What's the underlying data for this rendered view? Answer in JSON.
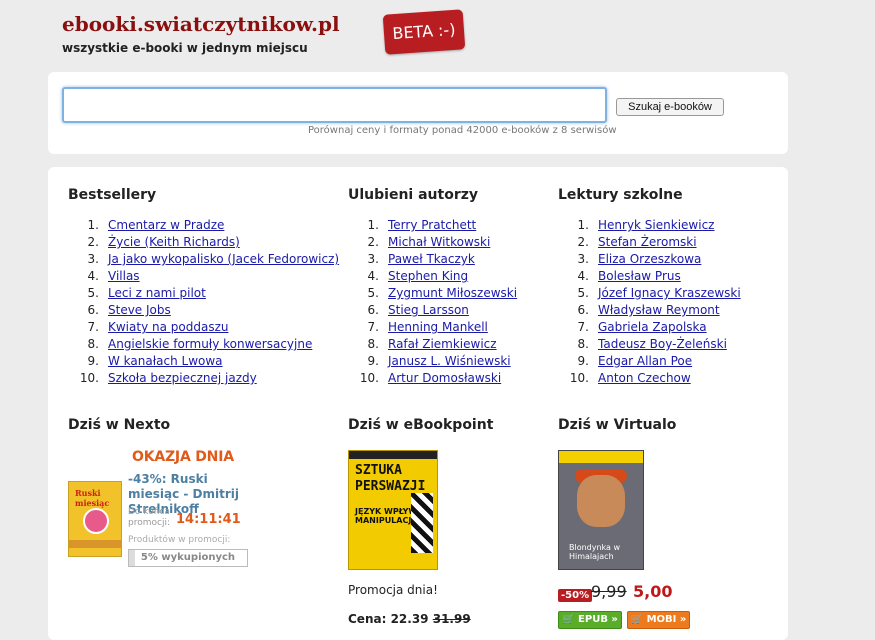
{
  "header": {
    "site_title": "ebooki.swiatczytnikow.pl",
    "tagline": "wszystkie e-booki w jednym miejscu",
    "beta_badge": "BETA :-)"
  },
  "search": {
    "value": "",
    "placeholder": "",
    "button_label": "Szukaj e-booków",
    "hint": "Porównaj ceny i formaty ponad 42000 e-booków z 8 serwisów"
  },
  "bestsellery": {
    "title": "Bestsellery",
    "items": [
      {
        "n": "1.",
        "label": "Cmentarz w Pradze"
      },
      {
        "n": "2.",
        "label": "Życie (Keith Richards)"
      },
      {
        "n": "3.",
        "label": "Ja jako wykopalisko (Jacek Fedorowicz)"
      },
      {
        "n": "4.",
        "label": "Villas"
      },
      {
        "n": "5.",
        "label": "Leci z nami pilot"
      },
      {
        "n": "6.",
        "label": "Steve Jobs"
      },
      {
        "n": "7.",
        "label": "Kwiaty na poddaszu"
      },
      {
        "n": "8.",
        "label": "Angielskie formuły konwersacyjne"
      },
      {
        "n": "9.",
        "label": "W kanałach Lwowa"
      },
      {
        "n": "10.",
        "label": "Szkoła bezpiecznej jazdy"
      }
    ]
  },
  "ulubieni": {
    "title": "Ulubieni autorzy",
    "items": [
      {
        "n": "1.",
        "label": "Terry Pratchett"
      },
      {
        "n": "2.",
        "label": "Michał Witkowski"
      },
      {
        "n": "3.",
        "label": "Paweł Tkaczyk"
      },
      {
        "n": "4.",
        "label": "Stephen King"
      },
      {
        "n": "5.",
        "label": "Zygmunt Miłoszewski"
      },
      {
        "n": "6.",
        "label": "Stieg Larsson"
      },
      {
        "n": "7.",
        "label": "Henning Mankell"
      },
      {
        "n": "8.",
        "label": "Rafał Ziemkiewicz"
      },
      {
        "n": "9.",
        "label": "Janusz L. Wiśniewski"
      },
      {
        "n": "10.",
        "label": "Artur Domosławski"
      }
    ]
  },
  "lektury": {
    "title": "Lektury szkolne",
    "items": [
      {
        "n": "1.",
        "label": "Henryk Sienkiewicz"
      },
      {
        "n": "2.",
        "label": "Stefan Żeromski"
      },
      {
        "n": "3.",
        "label": "Eliza Orzeszkowa"
      },
      {
        "n": "4.",
        "label": "Bolesław Prus"
      },
      {
        "n": "5.",
        "label": "Józef Ignacy Kraszewski"
      },
      {
        "n": "6.",
        "label": "Władysław Reymont"
      },
      {
        "n": "7.",
        "label": "Gabriela Zapolska"
      },
      {
        "n": "8.",
        "label": "Tadeusz Boy-Żeleński"
      },
      {
        "n": "9.",
        "label": "Edgar Allan Poe"
      },
      {
        "n": "10.",
        "label": "Anton Czechow"
      }
    ]
  },
  "nexto": {
    "title": "Dziś w Nexto",
    "banner": "OKAZJA DNIA",
    "book_title": "-43%: Ruski miesiąc - Dmitrij Strelnikoff",
    "cover_title": "Ruski miesiąc",
    "until_label": "Do końca promocji:",
    "timer": "14:11:41",
    "sold_label": "Produktów w promocji:",
    "sold_text": "5% wykupionych",
    "sold_fraction": 0.05
  },
  "ebookpoint": {
    "title": "Dziś w eBookpoint",
    "cover_line1": "SZTUKA",
    "cover_line2": "PERSWAZJI",
    "cover_line3": "JĘZYK WPŁYWU I MANIPULACJI",
    "promo": "Promocja dnia!",
    "price_label": "Cena: 22.39",
    "price_old": "31.99"
  },
  "virtualo": {
    "title": "Dziś w Virtualo",
    "cover_sub": "Blondynka w Himalajach",
    "discount": "-50%",
    "old_price": "9,99",
    "new_price": "5,00",
    "epub_label": "EPUB »",
    "mobi_label": "MOBI »"
  },
  "colors": {
    "brand": "#8a1010",
    "link": "#1a1aa8",
    "accent_orange": "#e05a1a",
    "epub_green": "#5aad2a",
    "mobi_orange": "#ee7a1e"
  }
}
